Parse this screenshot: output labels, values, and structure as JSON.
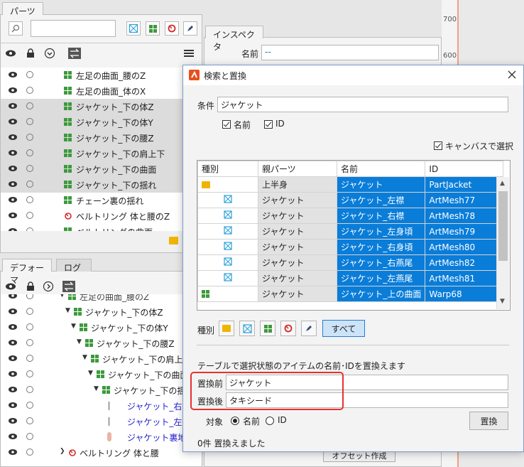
{
  "parts_panel": {
    "tab": "パーツ",
    "items": [
      {
        "label": "左足の曲面_腰のZ",
        "icon": "warp-icon"
      },
      {
        "label": "左足の曲面_体のX",
        "icon": "warp-icon"
      },
      {
        "label": "ジャケット_下の体Z",
        "icon": "warp-icon"
      },
      {
        "label": "ジャケット_下の体Y",
        "icon": "warp-icon"
      },
      {
        "label": "ジャケット_下の腰Z",
        "icon": "warp-icon"
      },
      {
        "label": "ジャケット_下の肩上下",
        "icon": "warp-icon"
      },
      {
        "label": "ジャケット_下の曲面",
        "icon": "warp-icon"
      },
      {
        "label": "ジャケット_下の揺れ",
        "icon": "warp-icon"
      },
      {
        "label": "チェーン裏の揺れ",
        "icon": "warp-icon"
      },
      {
        "label": "ベルトリング 体と腰のZ",
        "icon": "rotation-icon"
      },
      {
        "label": "ベルトリングの曲面",
        "icon": "warp-icon"
      }
    ]
  },
  "inspector": {
    "tab": "インスペクタ",
    "name_label": "名前",
    "name_value": "--"
  },
  "ruler": {
    "t700": "700",
    "t600": "600"
  },
  "deformer_panel": {
    "tabs": [
      "デフォーマ",
      "ログ"
    ],
    "items": [
      {
        "label": "左足の曲面_腰のZ"
      },
      {
        "label": "ジャケット_下の体Z"
      },
      {
        "label": "ジャケット_下の体Y"
      },
      {
        "label": "ジャケット_下の腰Z"
      },
      {
        "label": "ジャケット_下の肩上下"
      },
      {
        "label": "ジャケット_下の曲面"
      },
      {
        "label": "ジャケット_下の揺れ"
      },
      {
        "label": "ジャケット_右燕尾"
      },
      {
        "label": "ジャケット_左燕尾"
      },
      {
        "label": "ジャケット裏地"
      },
      {
        "label": "ベルトリング 体と腰"
      }
    ],
    "bottom_button": "オフセット作成"
  },
  "dialog": {
    "title": "検索と置換",
    "condition_label": "条件",
    "condition_value": "ジャケット",
    "check_name": "名前",
    "check_id": "ID",
    "check_canvas": "キャンバスで選択",
    "columns": [
      "種別",
      "親パーツ",
      "名前",
      "ID"
    ],
    "rows": [
      {
        "kind": "part",
        "parent": "上半身",
        "name": "ジャケット",
        "id": "PartJacket"
      },
      {
        "kind": "mesh",
        "parent": "ジャケット",
        "name": "ジャケット_左襟",
        "id": "ArtMesh77"
      },
      {
        "kind": "mesh",
        "parent": "ジャケット",
        "name": "ジャケット_右襟",
        "id": "ArtMesh78"
      },
      {
        "kind": "mesh",
        "parent": "ジャケット",
        "name": "ジャケット_左身頃",
        "id": "ArtMesh79"
      },
      {
        "kind": "mesh",
        "parent": "ジャケット",
        "name": "ジャケット_右身頃",
        "id": "ArtMesh80"
      },
      {
        "kind": "mesh",
        "parent": "ジャケット",
        "name": "ジャケット_右燕尾",
        "id": "ArtMesh82"
      },
      {
        "kind": "mesh",
        "parent": "ジャケット",
        "name": "ジャケット_左燕尾",
        "id": "ArtMesh81"
      },
      {
        "kind": "warp",
        "parent": "ジャケット",
        "name": "ジャケット_上の曲面",
        "id": "Warp68"
      }
    ],
    "kind_label": "種別",
    "all_button": "すべて",
    "replace_desc": "テーブルで選択状態のアイテムの名前･IDを置換えます",
    "before_label": "置換前",
    "before_value": "ジャケット",
    "after_label": "置換後",
    "after_value": "タキシード",
    "target_label": "対象",
    "radio_name": "名前",
    "radio_id": "ID",
    "replace_button": "置換",
    "status": "0件 置換えました"
  },
  "colors": {
    "selection": "#0a7dd9",
    "highlight": "#e8312f",
    "warp": "#3c9a3c",
    "mesh": "#2aa0d8",
    "part": "#f0b400"
  }
}
